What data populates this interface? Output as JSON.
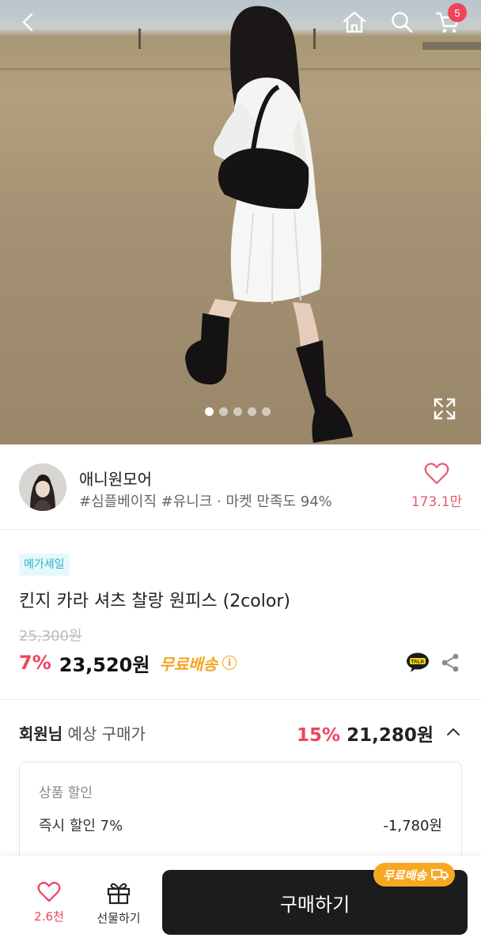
{
  "header": {
    "back_icon": "chevron-left-icon",
    "home_icon": "home-icon",
    "search_icon": "search-icon",
    "cart_icon": "cart-icon",
    "cart_count": "5"
  },
  "gallery": {
    "page_count": 5,
    "active_index": 0,
    "expand_icon": "expand-icon"
  },
  "shop": {
    "name": "애니원모어",
    "tags": "#심플베이직 #유니크 · 마켓 만족도 94%",
    "like_count": "173.1만"
  },
  "product": {
    "sale_badge": "메가세일",
    "title": "킨지 카라 셔츠 찰랑 원피스 (2color)",
    "original_price": "25,300원",
    "discount_rate": "7%",
    "price": "23,520원",
    "free_shipping": "무료배송",
    "info_mark": "i"
  },
  "member": {
    "label_bold": "회원님",
    "label_rest": " 예상 구매가",
    "discount_rate": "15%",
    "price": "21,280원"
  },
  "discount_detail": {
    "heading": "상품 할인",
    "item_label": "즉시 할인 7%",
    "item_value": "-1,780원"
  },
  "bottom_bar": {
    "like_count": "2.6천",
    "gift_label": "선물하기",
    "buy_label": "구매하기",
    "shipping_pill": "무료배송"
  },
  "colors": {
    "accent_red": "#f0445c",
    "free_shipping_orange": "#f3a51d",
    "sale_badge_teal": "#29b1c4",
    "buy_button": "#1c1c1c"
  }
}
